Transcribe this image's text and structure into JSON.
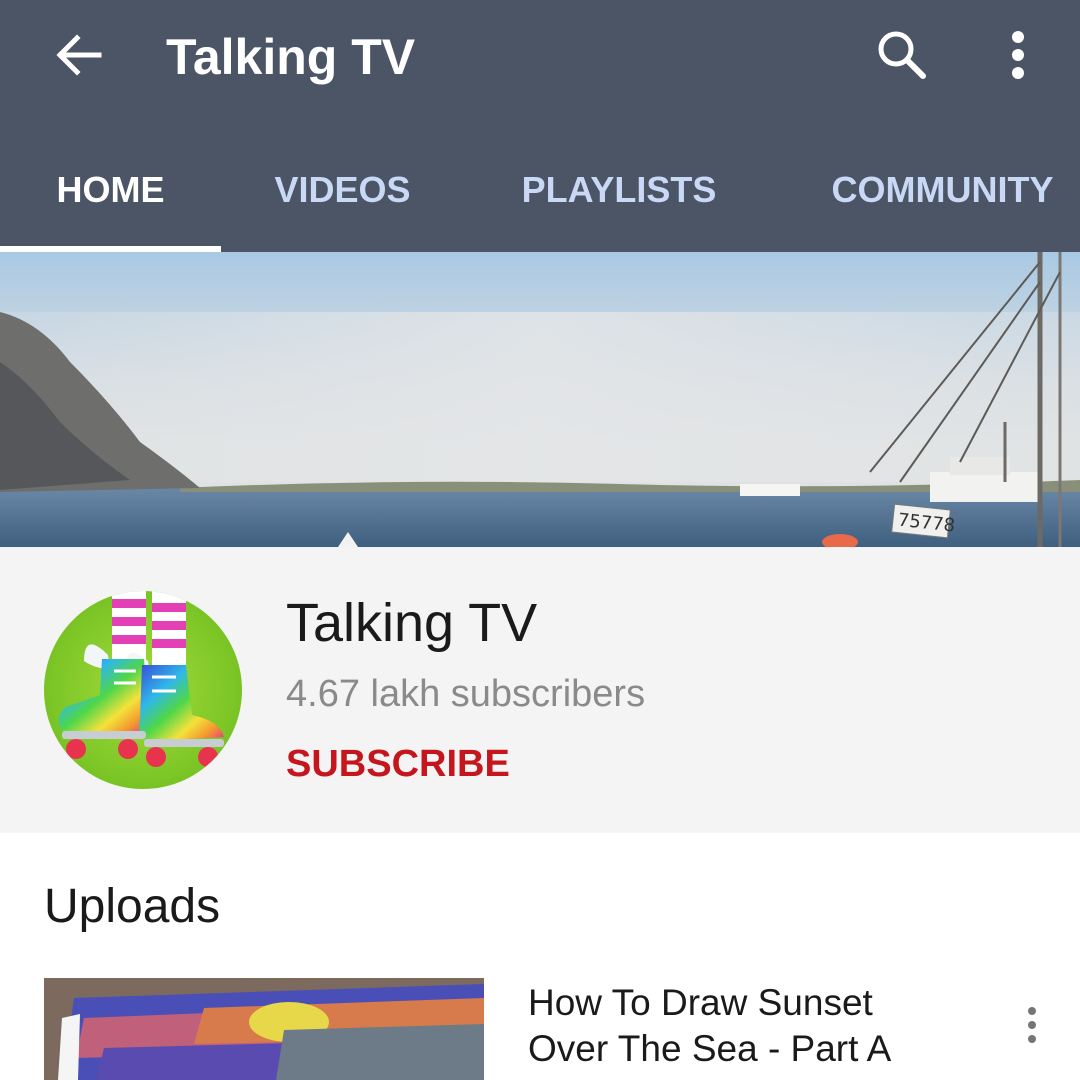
{
  "toolbar": {
    "title": "Talking TV",
    "back_icon": "arrow-back-icon",
    "search_icon": "search-icon",
    "more_icon": "more-vert-icon",
    "background_color": "#4b5565"
  },
  "tabs": [
    {
      "label": "HOME",
      "active": true
    },
    {
      "label": "VIDEOS",
      "active": false
    },
    {
      "label": "PLAYLISTS",
      "active": false
    },
    {
      "label": "COMMUNITY",
      "active": false
    }
  ],
  "channel": {
    "name": "Talking TV",
    "subscribers": "4.67 lakh subscribers",
    "subscribe_label": "SUBSCRIBE",
    "subscribe_color": "#c4161c",
    "banner_boat_number": "75778"
  },
  "uploads": {
    "section_title": "Uploads",
    "videos": [
      {
        "title_line_1": "How To Draw Sunset",
        "title_line_2": "Over The Sea - Part A",
        "more_icon": "more-vert-icon"
      }
    ]
  }
}
